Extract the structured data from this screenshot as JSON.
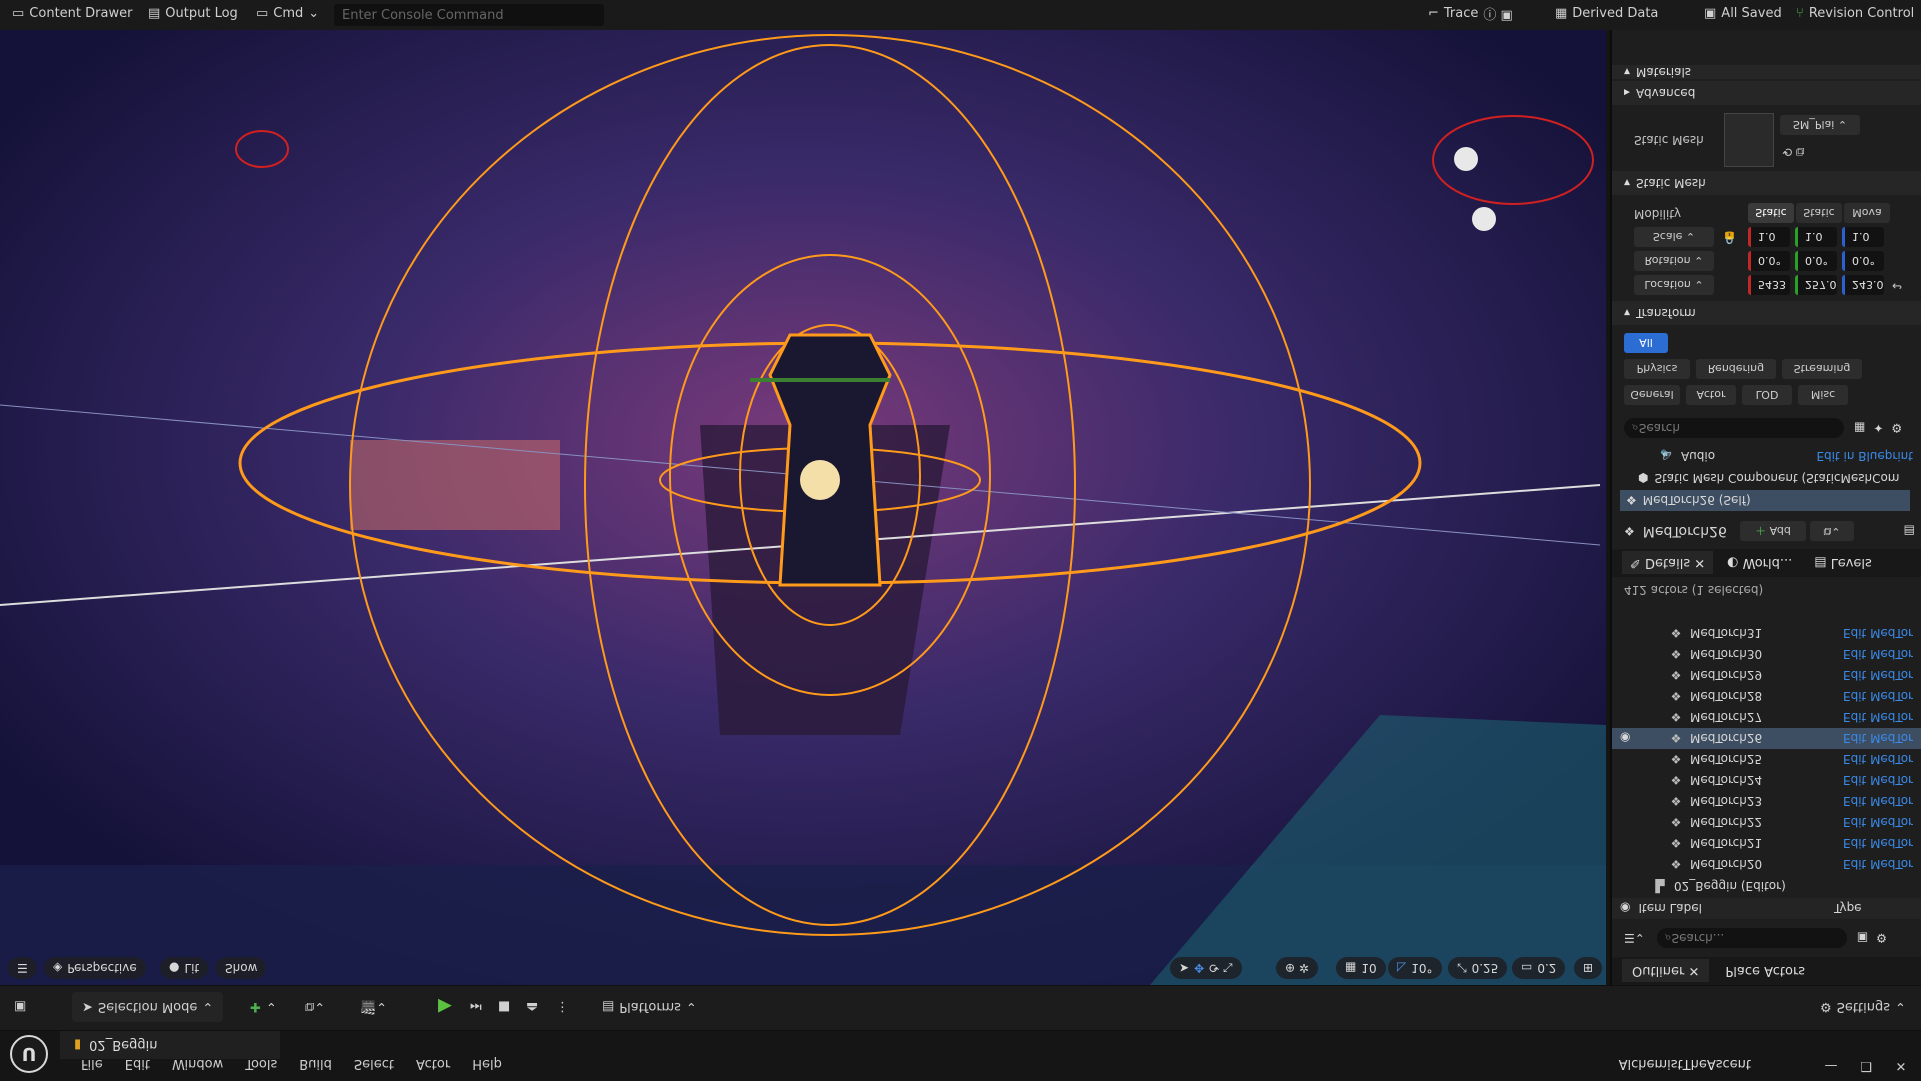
{
  "app": {
    "project": "AlchemistTheAscent",
    "menus": [
      "File",
      "Edit",
      "Window",
      "Tools",
      "Build",
      "Select",
      "Actor",
      "Help"
    ],
    "level_tab": "02_Beggin"
  },
  "toolbar": {
    "selection_mode": "Selection Mode",
    "platforms": "Platforms",
    "settings": "Settings"
  },
  "viewport": {
    "perspective": "Perspective",
    "lit": "Lit",
    "show": "Show",
    "grid": "10",
    "angle": "10°",
    "scale": "0.25",
    "camera_speed": "0.2"
  },
  "outliner": {
    "tab": "Outliner",
    "place_actors": "Place Actors",
    "search_placeholder": "Search...",
    "col_label": "Item Label",
    "col_type": "Type",
    "folder": "02_Beggin (Editor)",
    "rows": [
      {
        "label": "MedTorch20",
        "edit": "Edit MedTor"
      },
      {
        "label": "MedTorch21",
        "edit": "Edit MedTor"
      },
      {
        "label": "MedTorch22",
        "edit": "Edit MedTor"
      },
      {
        "label": "MedTorch23",
        "edit": "Edit MedTor"
      },
      {
        "label": "MedTorch24",
        "edit": "Edit MedTor"
      },
      {
        "label": "MedTorch25",
        "edit": "Edit MedTor"
      },
      {
        "label": "MedTorch26",
        "edit": "Edit MedTor"
      },
      {
        "label": "MedTorch27",
        "edit": "Edit MedTor"
      },
      {
        "label": "MedTorch28",
        "edit": "Edit MedTor"
      },
      {
        "label": "MedTorch29",
        "edit": "Edit MedTor"
      },
      {
        "label": "MedTorch30",
        "edit": "Edit MedTor"
      },
      {
        "label": "MedTorch31",
        "edit": "Edit MedTor"
      }
    ],
    "count": "412 actors (1 selected)"
  },
  "details": {
    "tabs": [
      "Details",
      "World...",
      "Levels"
    ],
    "actor": "MedTorch26",
    "add": "Add",
    "components": [
      "MedTorch26 (Self)",
      "Static Mesh Component (StaticMeshCom",
      "Audio"
    ],
    "edit_bp": "Edit in Blueprint",
    "search_placeholder": "Search",
    "filters": [
      "General",
      "Actor",
      "LOD",
      "Misc",
      "Physics",
      "Rendering",
      "Streaming",
      "All"
    ],
    "transform_title": "Transform",
    "location": {
      "label": "Location",
      "x": "5433",
      "y": "257.0",
      "z": "243.0"
    },
    "rotation": {
      "label": "Rotation",
      "x": "0.0°",
      "y": "0.0°",
      "z": "0.0°"
    },
    "scale": {
      "label": "Scale",
      "x": "1.0",
      "y": "1.0",
      "z": "1.0"
    },
    "mobility": {
      "label": "Mobility",
      "opts": [
        "Static",
        "Static",
        "Mova"
      ]
    },
    "static_mesh_title": "Static Mesh",
    "static_mesh_label": "Static Mesh",
    "mesh_name": "SM_Plai",
    "advanced": "Advanced",
    "materials": "Materials"
  },
  "console": {
    "content_drawer": "Content Drawer",
    "output_log": "Output Log",
    "cmd": "Cmd",
    "placeholder": "Enter Console Command",
    "trace": "Trace",
    "derived_data": "Derived Data",
    "saved": "All Saved",
    "revision": "Revision Control"
  }
}
